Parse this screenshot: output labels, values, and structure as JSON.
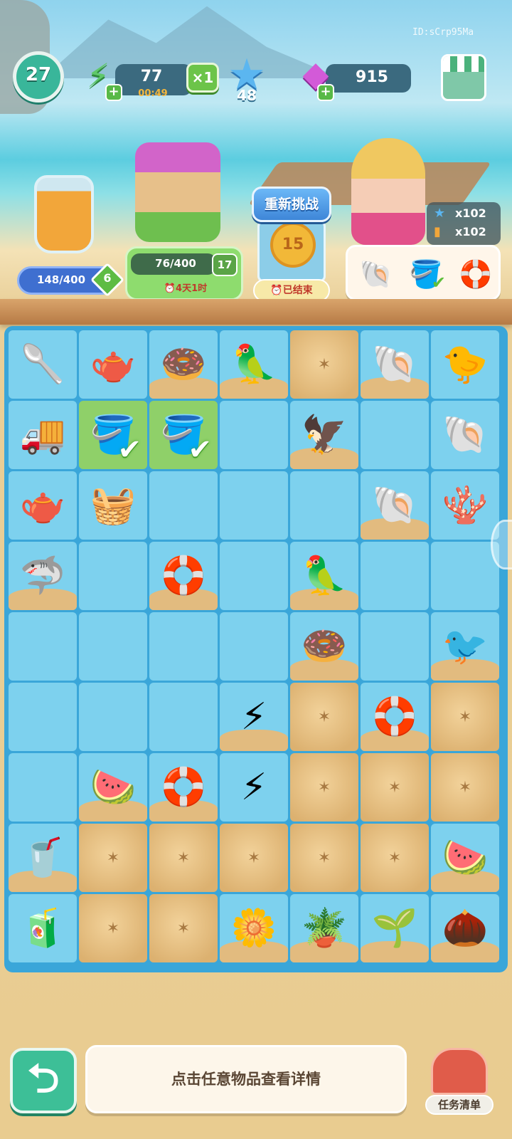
{
  "watermark": "ID:sCrp95Ma",
  "hud": {
    "level": "27",
    "energy": {
      "value": "77",
      "timer": "00:49",
      "plus": "+"
    },
    "multiplier": "×1",
    "stars": "48",
    "gems": {
      "value": "915",
      "plus": "+"
    },
    "icons": {
      "energy": "lightning-icon",
      "star": "star-icon",
      "gem": "gem-icon",
      "shop": "shop-stall-icon"
    }
  },
  "events": {
    "jar": {
      "progress": "148/400",
      "level": "6"
    },
    "tower": {
      "progress": "76/400",
      "level": "17",
      "timer": "⏰4天1时"
    },
    "challenge": {
      "retry_label": "重新挑战",
      "coin_value": "15",
      "status": "⏰已结束"
    },
    "character_multipliers": [
      {
        "icon": "star-icon",
        "value": "x102"
      },
      {
        "icon": "juice-icon",
        "value": "x102"
      }
    ],
    "requests": [
      {
        "name": "conch-shell",
        "glyph": "🐚"
      },
      {
        "name": "shovel-bucket",
        "glyph": "🪣",
        "done": true
      },
      {
        "name": "swim-ring-ball",
        "glyph": "🛟"
      }
    ]
  },
  "board": {
    "rows": [
      [
        {
          "n": "shovel",
          "g": "🥄",
          "t": "item"
        },
        {
          "n": "watering-can",
          "g": "🫖",
          "t": "item"
        },
        {
          "n": "donut-float",
          "g": "🍩",
          "t": "item-sand"
        },
        {
          "n": "cockatoo",
          "g": "🦜",
          "t": "item-sand"
        },
        {
          "n": "sand",
          "t": "sand"
        },
        {
          "n": "conch-shell",
          "g": "🐚",
          "t": "item-sand"
        },
        {
          "n": "yellow-bird",
          "g": "🐤",
          "t": "item"
        }
      ],
      [
        {
          "n": "toy-truck",
          "g": "🚚",
          "t": "item"
        },
        {
          "n": "shovel-bucket",
          "g": "🪣",
          "t": "selected"
        },
        {
          "n": "shovel-bucket",
          "g": "🪣",
          "t": "selected"
        },
        {
          "n": "empty",
          "t": "empty"
        },
        {
          "n": "vulture",
          "g": "🦅",
          "t": "item-sand"
        },
        {
          "n": "empty",
          "t": "empty"
        },
        {
          "n": "spiral-shell",
          "g": "🐚",
          "t": "item"
        }
      ],
      [
        {
          "n": "watering-can",
          "g": "🫖",
          "t": "item"
        },
        {
          "n": "picnic-basket",
          "g": "🧺",
          "t": "item"
        },
        {
          "n": "empty",
          "t": "empty"
        },
        {
          "n": "empty",
          "t": "empty"
        },
        {
          "n": "empty",
          "t": "empty"
        },
        {
          "n": "conch-shell",
          "g": "🐚",
          "t": "item-sand"
        },
        {
          "n": "coral-shells",
          "g": "🪸",
          "t": "item"
        }
      ],
      [
        {
          "n": "shark-float",
          "g": "🦈",
          "t": "item-sand"
        },
        {
          "n": "empty",
          "t": "empty"
        },
        {
          "n": "swim-ring-ball",
          "g": "🛟",
          "t": "item-sand"
        },
        {
          "n": "empty",
          "t": "empty"
        },
        {
          "n": "parrot",
          "g": "🦜",
          "t": "item-sand"
        },
        {
          "n": "empty",
          "t": "empty"
        },
        {
          "n": "empty",
          "t": "empty"
        }
      ],
      [
        {
          "n": "empty",
          "t": "empty"
        },
        {
          "n": "empty",
          "t": "empty"
        },
        {
          "n": "empty",
          "t": "empty"
        },
        {
          "n": "empty",
          "t": "empty"
        },
        {
          "n": "donut-float",
          "g": "🍩",
          "t": "item-sand"
        },
        {
          "n": "empty",
          "t": "empty"
        },
        {
          "n": "seabird",
          "g": "🐦",
          "t": "item-sand"
        }
      ],
      [
        {
          "n": "empty",
          "t": "empty"
        },
        {
          "n": "empty",
          "t": "empty"
        },
        {
          "n": "empty",
          "t": "empty"
        },
        {
          "n": "energy-pair",
          "g": "⚡",
          "t": "item-sand"
        },
        {
          "n": "sand",
          "t": "sand"
        },
        {
          "n": "swim-ring-ball",
          "g": "🛟",
          "t": "item-sand"
        },
        {
          "n": "sand",
          "t": "sand"
        }
      ],
      [
        {
          "n": "empty",
          "t": "empty"
        },
        {
          "n": "watermelon-juice",
          "g": "🍉",
          "t": "item-sand"
        },
        {
          "n": "swim-ring-ball",
          "g": "🛟",
          "t": "item-sand"
        },
        {
          "n": "energy-pair",
          "g": "⚡",
          "t": "item"
        },
        {
          "n": "sand",
          "t": "sand"
        },
        {
          "n": "sand",
          "t": "sand"
        },
        {
          "n": "sand",
          "t": "sand"
        }
      ],
      [
        {
          "n": "smoothie",
          "g": "🥤",
          "t": "item-sand"
        },
        {
          "n": "sand",
          "t": "sand"
        },
        {
          "n": "sand",
          "t": "sand"
        },
        {
          "n": "sand",
          "t": "sand"
        },
        {
          "n": "sand",
          "t": "sand"
        },
        {
          "n": "sand",
          "t": "sand"
        },
        {
          "n": "watermelon-plate",
          "g": "🍉",
          "t": "item-sand"
        }
      ],
      [
        {
          "n": "juicer",
          "g": "🧃",
          "t": "item"
        },
        {
          "n": "sand",
          "t": "sand"
        },
        {
          "n": "sand",
          "t": "sand"
        },
        {
          "n": "yellow-flowers",
          "g": "🌼",
          "t": "item-sand"
        },
        {
          "n": "potted-plant",
          "g": "🪴",
          "t": "item-sand"
        },
        {
          "n": "sprout",
          "g": "🌱",
          "t": "item-sand"
        },
        {
          "n": "seed",
          "g": "🌰",
          "t": "item-sand"
        }
      ]
    ]
  },
  "footer": {
    "back_glyph": "⮌",
    "hint": "点击任意物品查看详情",
    "task_label": "任务清单"
  }
}
